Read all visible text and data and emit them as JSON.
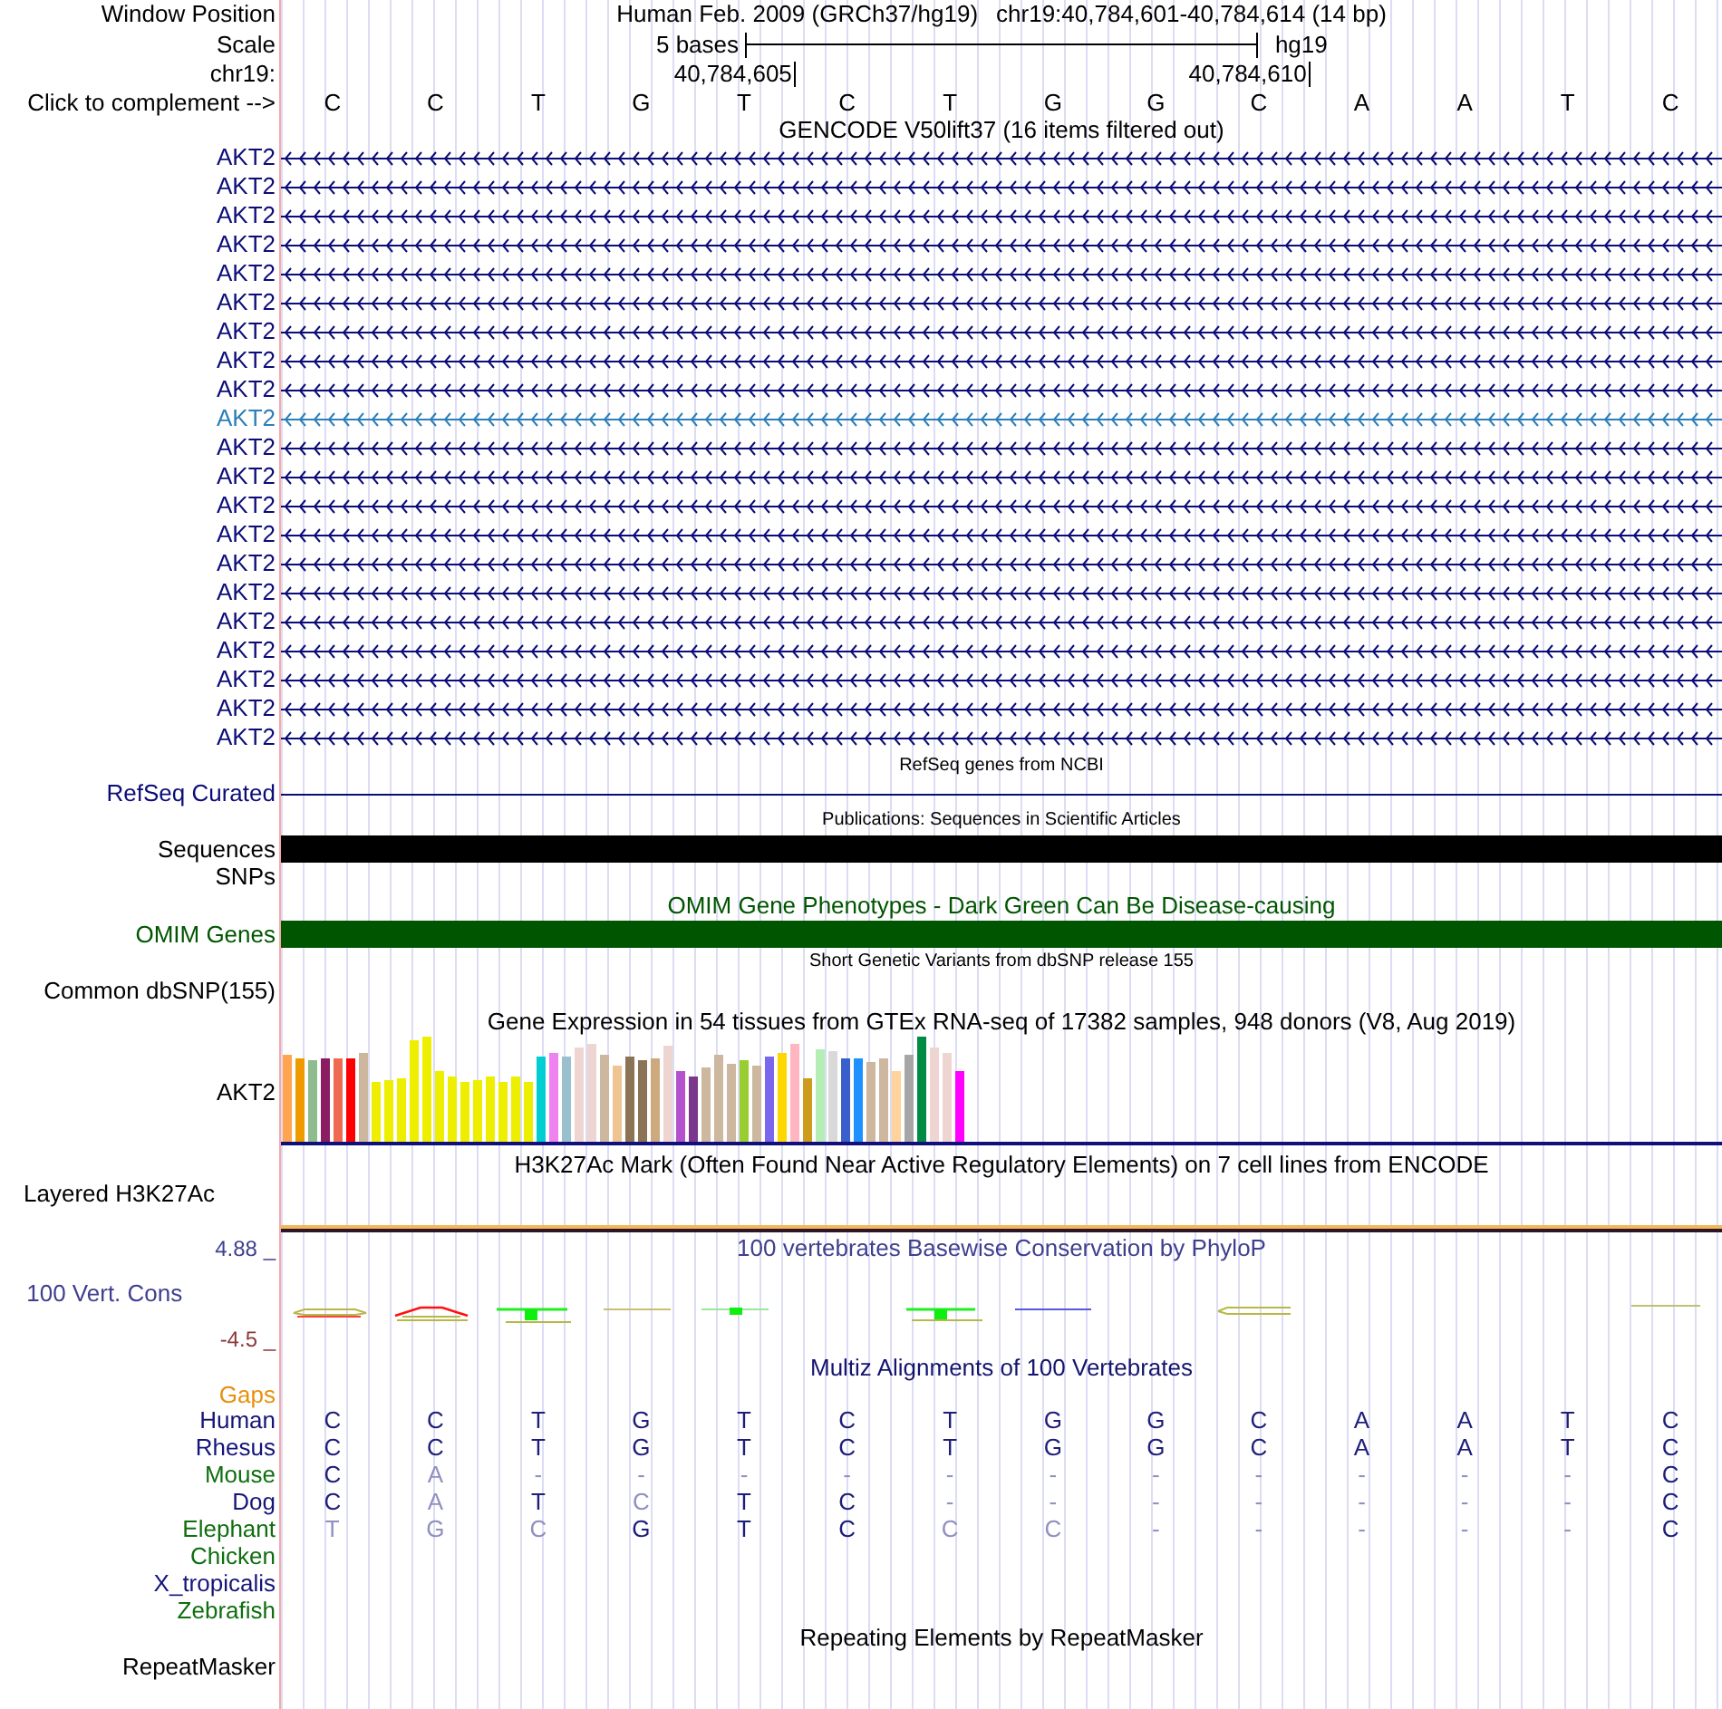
{
  "header": {
    "position": {
      "label": "Window Position",
      "assembly": "Human Feb. 2009 (GRCh37/hg19)",
      "range": "chr19:40,784,601-40,784,614 (14 bp)"
    },
    "scale": {
      "label": "Scale",
      "size": "5 bases",
      "build": "hg19"
    },
    "ruler": {
      "label": "chr19:",
      "ticks": [
        "40,784,605",
        "40,784,610"
      ]
    },
    "bases": {
      "label": "Click to complement -->",
      "letters": [
        "C",
        "C",
        "T",
        "G",
        "T",
        "C",
        "T",
        "G",
        "G",
        "C",
        "A",
        "A",
        "T",
        "C"
      ]
    }
  },
  "tracks": [
    {
      "kind": "genes",
      "title": "GENCODE V50lift37 (16 items filtered out)",
      "items": [
        {
          "label": "AKT2",
          "color": "#0c0c78"
        },
        {
          "label": "AKT2",
          "color": "#0c0c78"
        },
        {
          "label": "AKT2",
          "color": "#0c0c78"
        },
        {
          "label": "AKT2",
          "color": "#0c0c78"
        },
        {
          "label": "AKT2",
          "color": "#0c0c78"
        },
        {
          "label": "AKT2",
          "color": "#0c0c78"
        },
        {
          "label": "AKT2",
          "color": "#0c0c78"
        },
        {
          "label": "AKT2",
          "color": "#0c0c78"
        },
        {
          "label": "AKT2",
          "color": "#0c0c78"
        },
        {
          "label": "AKT2",
          "color": "#2b7fb8"
        },
        {
          "label": "AKT2",
          "color": "#0c0c78"
        },
        {
          "label": "AKT2",
          "color": "#0c0c78"
        },
        {
          "label": "AKT2",
          "color": "#0c0c78"
        },
        {
          "label": "AKT2",
          "color": "#0c0c78"
        },
        {
          "label": "AKT2",
          "color": "#0c0c78"
        },
        {
          "label": "AKT2",
          "color": "#0c0c78"
        },
        {
          "label": "AKT2",
          "color": "#0c0c78"
        },
        {
          "label": "AKT2",
          "color": "#0c0c78"
        },
        {
          "label": "AKT2",
          "color": "#0c0c78"
        },
        {
          "label": "AKT2",
          "color": "#0c0c78"
        },
        {
          "label": "AKT2",
          "color": "#0c0c78"
        }
      ]
    },
    {
      "kind": "line",
      "caption": "RefSeq genes from NCBI",
      "label": "RefSeq Curated",
      "color": "#0c0c78"
    },
    {
      "kind": "bar",
      "caption": "Publications: Sequences in Scientific Articles",
      "label": "Sequences",
      "color": "#000000"
    },
    {
      "kind": "empty",
      "label": "SNPs"
    },
    {
      "kind": "bar",
      "title": "OMIM Gene Phenotypes - Dark Green Can Be Disease-causing",
      "label": "OMIM Genes",
      "color": "#005500"
    },
    {
      "kind": "empty",
      "caption": "Short Genetic Variants from dbSNP release 155",
      "label": "Common dbSNP(155)"
    },
    {
      "kind": "expression",
      "title": "Gene Expression in 54 tissues from GTEx RNA-seq of 17382 samples, 948 donors (V8, Aug 2019)",
      "label": "AKT2",
      "bars": [
        {
          "color": "#ffa54f"
        },
        {
          "color": "#ee9a00"
        },
        {
          "color": "#8fbc8f"
        },
        {
          "color": "#8b1c62"
        },
        {
          "color": "#ee6a50"
        },
        {
          "color": "#ff0000"
        },
        {
          "color": "#cdb79e"
        },
        {
          "color": "#eeee00"
        },
        {
          "color": "#eeee00"
        },
        {
          "color": "#eeee00"
        },
        {
          "color": "#eeee00"
        },
        {
          "color": "#eeee00"
        },
        {
          "color": "#eeee00"
        },
        {
          "color": "#eeee00"
        },
        {
          "color": "#eeee00"
        },
        {
          "color": "#eeee00"
        },
        {
          "color": "#eeee00"
        },
        {
          "color": "#eeee00"
        },
        {
          "color": "#eeee00"
        },
        {
          "color": "#eeee00"
        },
        {
          "color": "#00ced1"
        },
        {
          "color": "#ee82ee"
        },
        {
          "color": "#9ac0cd"
        },
        {
          "color": "#eed5d2"
        },
        {
          "color": "#eed5d2"
        },
        {
          "color": "#cdb79e"
        },
        {
          "color": "#eec591"
        },
        {
          "color": "#8b7355"
        },
        {
          "color": "#8b7355"
        },
        {
          "color": "#cdaa7d"
        },
        {
          "color": "#eed5d2"
        },
        {
          "color": "#b452cd"
        },
        {
          "color": "#7a378b"
        },
        {
          "color": "#cdb79e"
        },
        {
          "color": "#cdb79e"
        },
        {
          "color": "#cdb79e"
        },
        {
          "color": "#9acd32"
        },
        {
          "color": "#cdb79e"
        },
        {
          "color": "#7a67ee"
        },
        {
          "color": "#ffd700"
        },
        {
          "color": "#ffb6c1"
        },
        {
          "color": "#cd9b1d"
        },
        {
          "color": "#b4eeb4"
        },
        {
          "color": "#d9d9d9"
        },
        {
          "color": "#3a5fcd"
        },
        {
          "color": "#1e90ff"
        },
        {
          "color": "#cdb79e"
        },
        {
          "color": "#cdb79e"
        },
        {
          "color": "#ffd39b"
        },
        {
          "color": "#a6a6a6"
        },
        {
          "color": "#008b45"
        },
        {
          "color": "#eed5d2"
        },
        {
          "color": "#eed5d2"
        },
        {
          "color": "#ff00ff"
        }
      ]
    },
    {
      "kind": "layered",
      "title": "H3K27Ac Mark (Often Found Near Active Regulatory Elements) on 7 cell lines from ENCODE",
      "label": "Layered H3K27Ac"
    },
    {
      "kind": "wiggle",
      "title": "100 vertebrates Basewise Conservation by PhyloP",
      "label": "100 Vert. Cons",
      "color": "#3f3f8f",
      "max": {
        "text": "4.88 _",
        "color": "#3f3f8f"
      },
      "min": {
        "text": "-4.5 _",
        "color": "#8b3a3a"
      }
    },
    {
      "kind": "alignment",
      "title": "Multiz Alignments of 100 Vertebrates",
      "color": "#14146e",
      "gaps": {
        "label": "Gaps",
        "color": "#e8900c"
      },
      "species": [
        {
          "label": "Human",
          "color": "#14147a",
          "bases": [
            {
              "letter": "C",
              "match": true
            },
            {
              "letter": "C",
              "match": true
            },
            {
              "letter": "T",
              "match": true
            },
            {
              "letter": "G",
              "match": true
            },
            {
              "letter": "T",
              "match": true
            },
            {
              "letter": "C",
              "match": true
            },
            {
              "letter": "T",
              "match": true
            },
            {
              "letter": "G",
              "match": true
            },
            {
              "letter": "G",
              "match": true
            },
            {
              "letter": "C",
              "match": true
            },
            {
              "letter": "A",
              "match": true
            },
            {
              "letter": "A",
              "match": true
            },
            {
              "letter": "T",
              "match": true
            },
            {
              "letter": "C",
              "match": true
            }
          ]
        },
        {
          "label": "Rhesus",
          "color": "#14147a",
          "bases": [
            {
              "letter": "C",
              "match": true
            },
            {
              "letter": "C",
              "match": true
            },
            {
              "letter": "T",
              "match": true
            },
            {
              "letter": "G",
              "match": true
            },
            {
              "letter": "T",
              "match": true
            },
            {
              "letter": "C",
              "match": true
            },
            {
              "letter": "T",
              "match": true
            },
            {
              "letter": "G",
              "match": true
            },
            {
              "letter": "G",
              "match": true
            },
            {
              "letter": "C",
              "match": true
            },
            {
              "letter": "A",
              "match": true
            },
            {
              "letter": "A",
              "match": true
            },
            {
              "letter": "T",
              "match": true
            },
            {
              "letter": "C",
              "match": true
            }
          ]
        },
        {
          "label": "Mouse",
          "color": "#0f6e0f",
          "bases": [
            {
              "letter": "C",
              "match": true
            },
            {
              "letter": "A",
              "match": false
            },
            {
              "letter": "-",
              "match": false
            },
            {
              "letter": "-",
              "match": false
            },
            {
              "letter": "-",
              "match": false
            },
            {
              "letter": "-",
              "match": false
            },
            {
              "letter": "-",
              "match": false
            },
            {
              "letter": "-",
              "match": false
            },
            {
              "letter": "-",
              "match": false
            },
            {
              "letter": "-",
              "match": false
            },
            {
              "letter": "-",
              "match": false
            },
            {
              "letter": "-",
              "match": false
            },
            {
              "letter": "-",
              "match": false
            },
            {
              "letter": "C",
              "match": true
            }
          ]
        },
        {
          "label": "Dog",
          "color": "#14147a",
          "bases": [
            {
              "letter": "C",
              "match": true
            },
            {
              "letter": "A",
              "match": false
            },
            {
              "letter": "T",
              "match": true
            },
            {
              "letter": "C",
              "match": false
            },
            {
              "letter": "T",
              "match": true
            },
            {
              "letter": "C",
              "match": true
            },
            {
              "letter": "-",
              "match": false
            },
            {
              "letter": "-",
              "match": false
            },
            {
              "letter": "-",
              "match": false
            },
            {
              "letter": "-",
              "match": false
            },
            {
              "letter": "-",
              "match": false
            },
            {
              "letter": "-",
              "match": false
            },
            {
              "letter": "-",
              "match": false
            },
            {
              "letter": "C",
              "match": true
            }
          ]
        },
        {
          "label": "Elephant",
          "color": "#0f6e0f",
          "bases": [
            {
              "letter": "T",
              "match": false
            },
            {
              "letter": "G",
              "match": false
            },
            {
              "letter": "C",
              "match": false
            },
            {
              "letter": "G",
              "match": true
            },
            {
              "letter": "T",
              "match": true
            },
            {
              "letter": "C",
              "match": true
            },
            {
              "letter": "C",
              "match": false
            },
            {
              "letter": "C",
              "match": false
            },
            {
              "letter": "-",
              "match": false
            },
            {
              "letter": "-",
              "match": false
            },
            {
              "letter": "-",
              "match": false
            },
            {
              "letter": "-",
              "match": false
            },
            {
              "letter": "-",
              "match": false
            },
            {
              "letter": "C",
              "match": true
            }
          ]
        },
        {
          "label": "Chicken",
          "color": "#0f6e0f"
        },
        {
          "label": "X_tropicalis",
          "color": "#14147a"
        },
        {
          "label": "Zebrafish",
          "color": "#0f6e0f"
        }
      ]
    },
    {
      "kind": "empty",
      "title": "Repeating Elements by RepeatMasker",
      "label": "RepeatMasker"
    }
  ]
}
